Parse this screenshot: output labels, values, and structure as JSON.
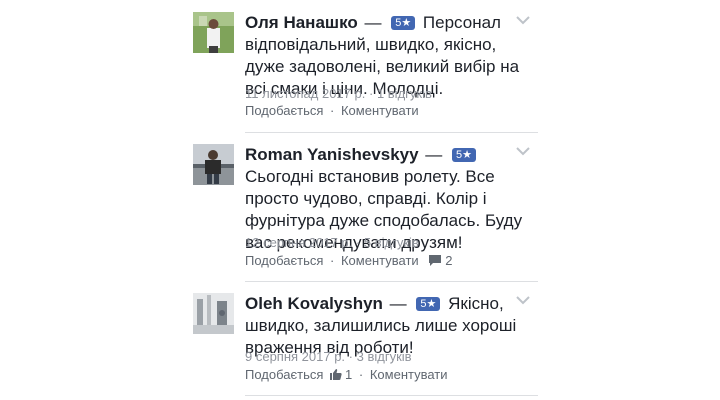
{
  "reviews": [
    {
      "author": "Оля Нанашко",
      "separator": "—",
      "rating": "5★",
      "text": "Персонал відповідальний, швидко, якісно, дуже задоволені, великий вибір на всі смаки і ціни. Молодці.",
      "date": "11 листопад 2017 р.",
      "replies": "1 відгуків",
      "dot": "·",
      "like_label": "Подобається",
      "comment_label": "Коментувати"
    },
    {
      "author": "Roman Yanishevskyy",
      "separator": "—",
      "rating": "5★",
      "text": "Сьогодні встановив ролету. Все просто чудово, справді. Колір і фурнітура дуже сподобалась. Буду вас рекомендувати друзям!",
      "date": "12 серпня 2017 р.",
      "replies": "5 відгуків",
      "dot": "·",
      "like_label": "Подобається",
      "comment_label": "Коментувати",
      "comment_count": "2"
    },
    {
      "author": "Oleh Kovalyshyn",
      "separator": "—",
      "rating": "5★",
      "text": "Якісно, швидко, залишились лише хороші враження від роботи!",
      "date": "9 серпня 2017 р.",
      "replies": "3 відгуків",
      "dot": "·",
      "like_label": "Подобається",
      "comment_label": "Коментувати",
      "like_count": "1"
    }
  ],
  "colors": {
    "badge": "#4267b2",
    "meta": "#90949c",
    "action": "#606770",
    "divider": "#dddfe2"
  },
  "icons": {
    "menu": "chevron-down-icon",
    "comment_count": "comment-icon",
    "like_count": "thumbs-up-icon"
  }
}
